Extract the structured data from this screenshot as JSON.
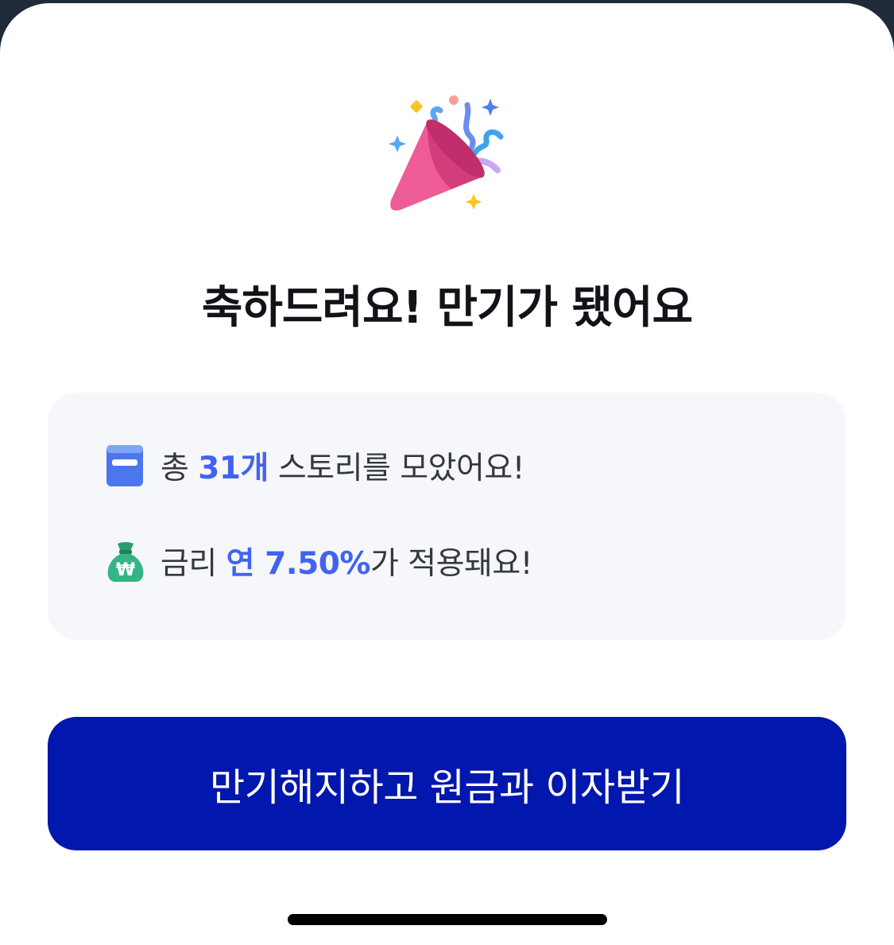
{
  "title": "축하드려요! 만기가 됐어요",
  "summary": {
    "stories": {
      "icon": "book-icon",
      "prefix": "총 ",
      "highlight": "31개",
      "suffix": " 스토리를 모았어요!"
    },
    "interest": {
      "icon": "money-bag-icon",
      "prefix": "금리 ",
      "highlight": "연 7.50%",
      "suffix": "가 적용돼요!"
    }
  },
  "cta_label": "만기해지하고 원금과 이자받기",
  "colors": {
    "accent": "#4263f0",
    "button": "#0217ad",
    "card_bg": "#f6f7fa"
  }
}
